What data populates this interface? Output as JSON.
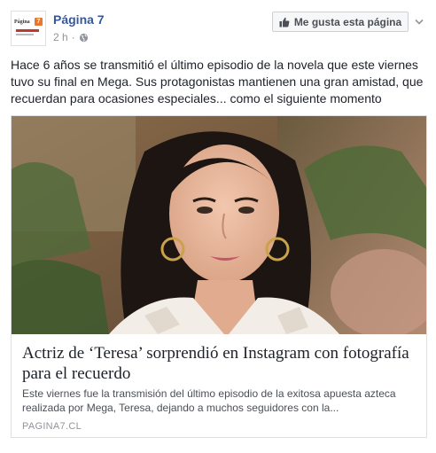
{
  "header": {
    "page_name": "Página 7",
    "timestamp": "2 h",
    "separator": "·",
    "privacy_icon": "globe-icon",
    "like_button_label": "Me gusta esta página",
    "like_button_icon": "thumbs-up-icon",
    "options_icon": "chevron-down-icon"
  },
  "avatar": {
    "logo_text": "Página",
    "logo_number": "7"
  },
  "post": {
    "text": "Hace 6 años se transmitió el último episodio de la novela que este viernes tuvo su final en Mega. Sus protagonistas mantienen una gran amistad, que recuerdan para ocasiones especiales... como el siguiente momento"
  },
  "link_preview": {
    "title": "Actriz de ‘Teresa’ sorprendió en Instagram con fotografía para el recuerdo",
    "description": "Este viernes fue la transmisión del último episodio de la exitosa apuesta azteca realizada por Mega, Teresa, dejando a muchos seguidores con la...",
    "domain": "PAGINA7.CL"
  },
  "colors": {
    "link_blue": "#365899",
    "meta_gray": "#90949c",
    "logo_orange": "#e8762c"
  }
}
